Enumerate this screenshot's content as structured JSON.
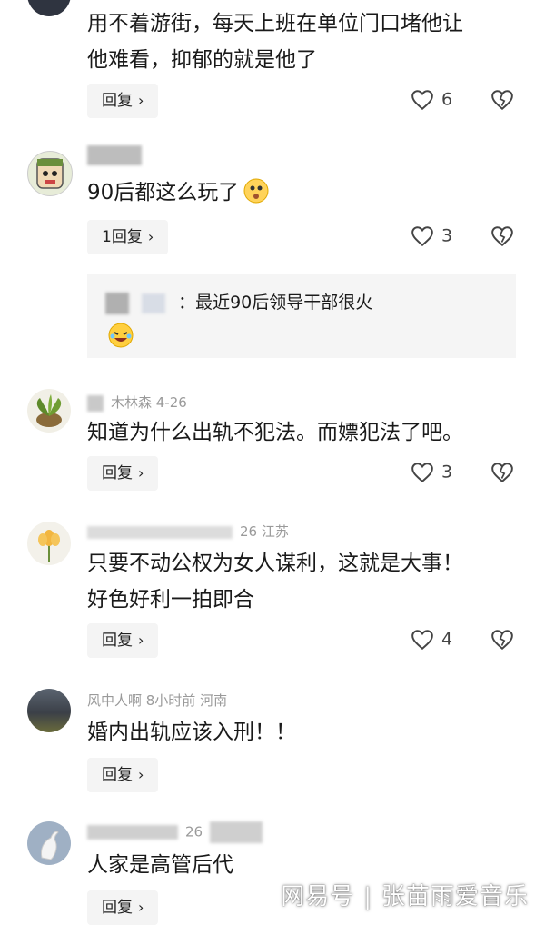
{
  "comments": [
    {
      "meta": "",
      "lines": [
        "用不着游街，每天上班在单位门口堵他让",
        "他难看，抑郁的就是他了"
      ],
      "reply_label": "回复",
      "likes": "6"
    },
    {
      "meta": "",
      "lines": [
        "90后都这么玩了"
      ],
      "reply_label": "1回复",
      "likes": "3",
      "sub_reply": "：最近90后领导干部很火"
    },
    {
      "meta": "木林森  4-26",
      "lines": [
        "知道为什么出轨不犯法。而嫖犯法了吧。"
      ],
      "reply_label": "回复",
      "likes": "3"
    },
    {
      "meta": "26  江苏",
      "lines": [
        "只要不动公权为女人谋利，这就是大事！",
        "好色好利一拍即合"
      ],
      "reply_label": "回复",
      "likes": "4"
    },
    {
      "meta": "风中人啊  8小时前  河南",
      "lines": [
        "婚内出轨应该入刑！！"
      ],
      "reply_label": "回复"
    },
    {
      "meta": "26",
      "lines": [
        "人家是高管后代"
      ],
      "reply_label": "回复"
    }
  ],
  "icons": {
    "like": "heart-outline-icon",
    "dislike": "broken-heart-icon",
    "chevron": "›"
  },
  "watermark": {
    "brand": "网易号",
    "separator": "|",
    "author": "张苗雨爱音乐"
  }
}
